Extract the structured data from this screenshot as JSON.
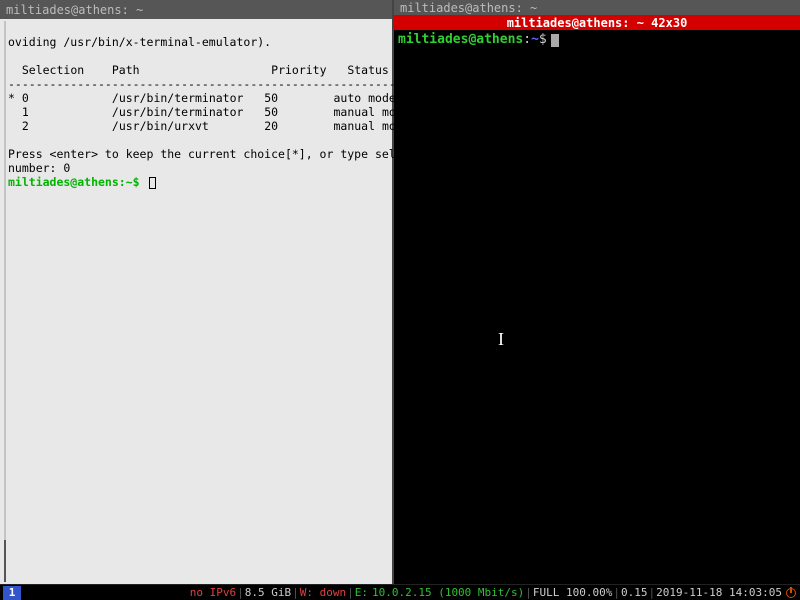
{
  "left": {
    "title": "miltiades@athens: ~",
    "oviding_line": "oviding /usr/bin/x-terminal-emulator).",
    "headers": {
      "sel": "Selection",
      "path": "Path",
      "prio": "Priority",
      "status": "Status"
    },
    "rows": [
      {
        "mark": "*",
        "sel": "0",
        "path": "/usr/bin/terminator",
        "prio": "50",
        "status": "auto mode"
      },
      {
        "mark": " ",
        "sel": "1",
        "path": "/usr/bin/terminator",
        "prio": "50",
        "status": "manual mode"
      },
      {
        "mark": " ",
        "sel": "2",
        "path": "/usr/bin/urxvt",
        "prio": "20",
        "status": "manual mode"
      }
    ],
    "press_line": "Press <enter> to keep the current choice[*], or type selection",
    "number_line": "number: 0",
    "prompt": "miltiades@athens:~$"
  },
  "right": {
    "title_dark": "miltiades@athens: ~",
    "title_red": "miltiades@athens: ~ 42x30",
    "prompt_user": "miltiades@athens",
    "prompt_colon": ":",
    "prompt_path": "~",
    "prompt_dollar": "$"
  },
  "status": {
    "workspace": "1",
    "ipv6": "no IPv6",
    "mem": "8.5 GiB",
    "wifi": "W: down",
    "eth_label": "E:",
    "eth_val": "10.0.2.15 (1000 Mbit/s)",
    "bat": "FULL 100.00%",
    "load": "0.15",
    "datetime": "2019-11-18 14:03:05"
  }
}
